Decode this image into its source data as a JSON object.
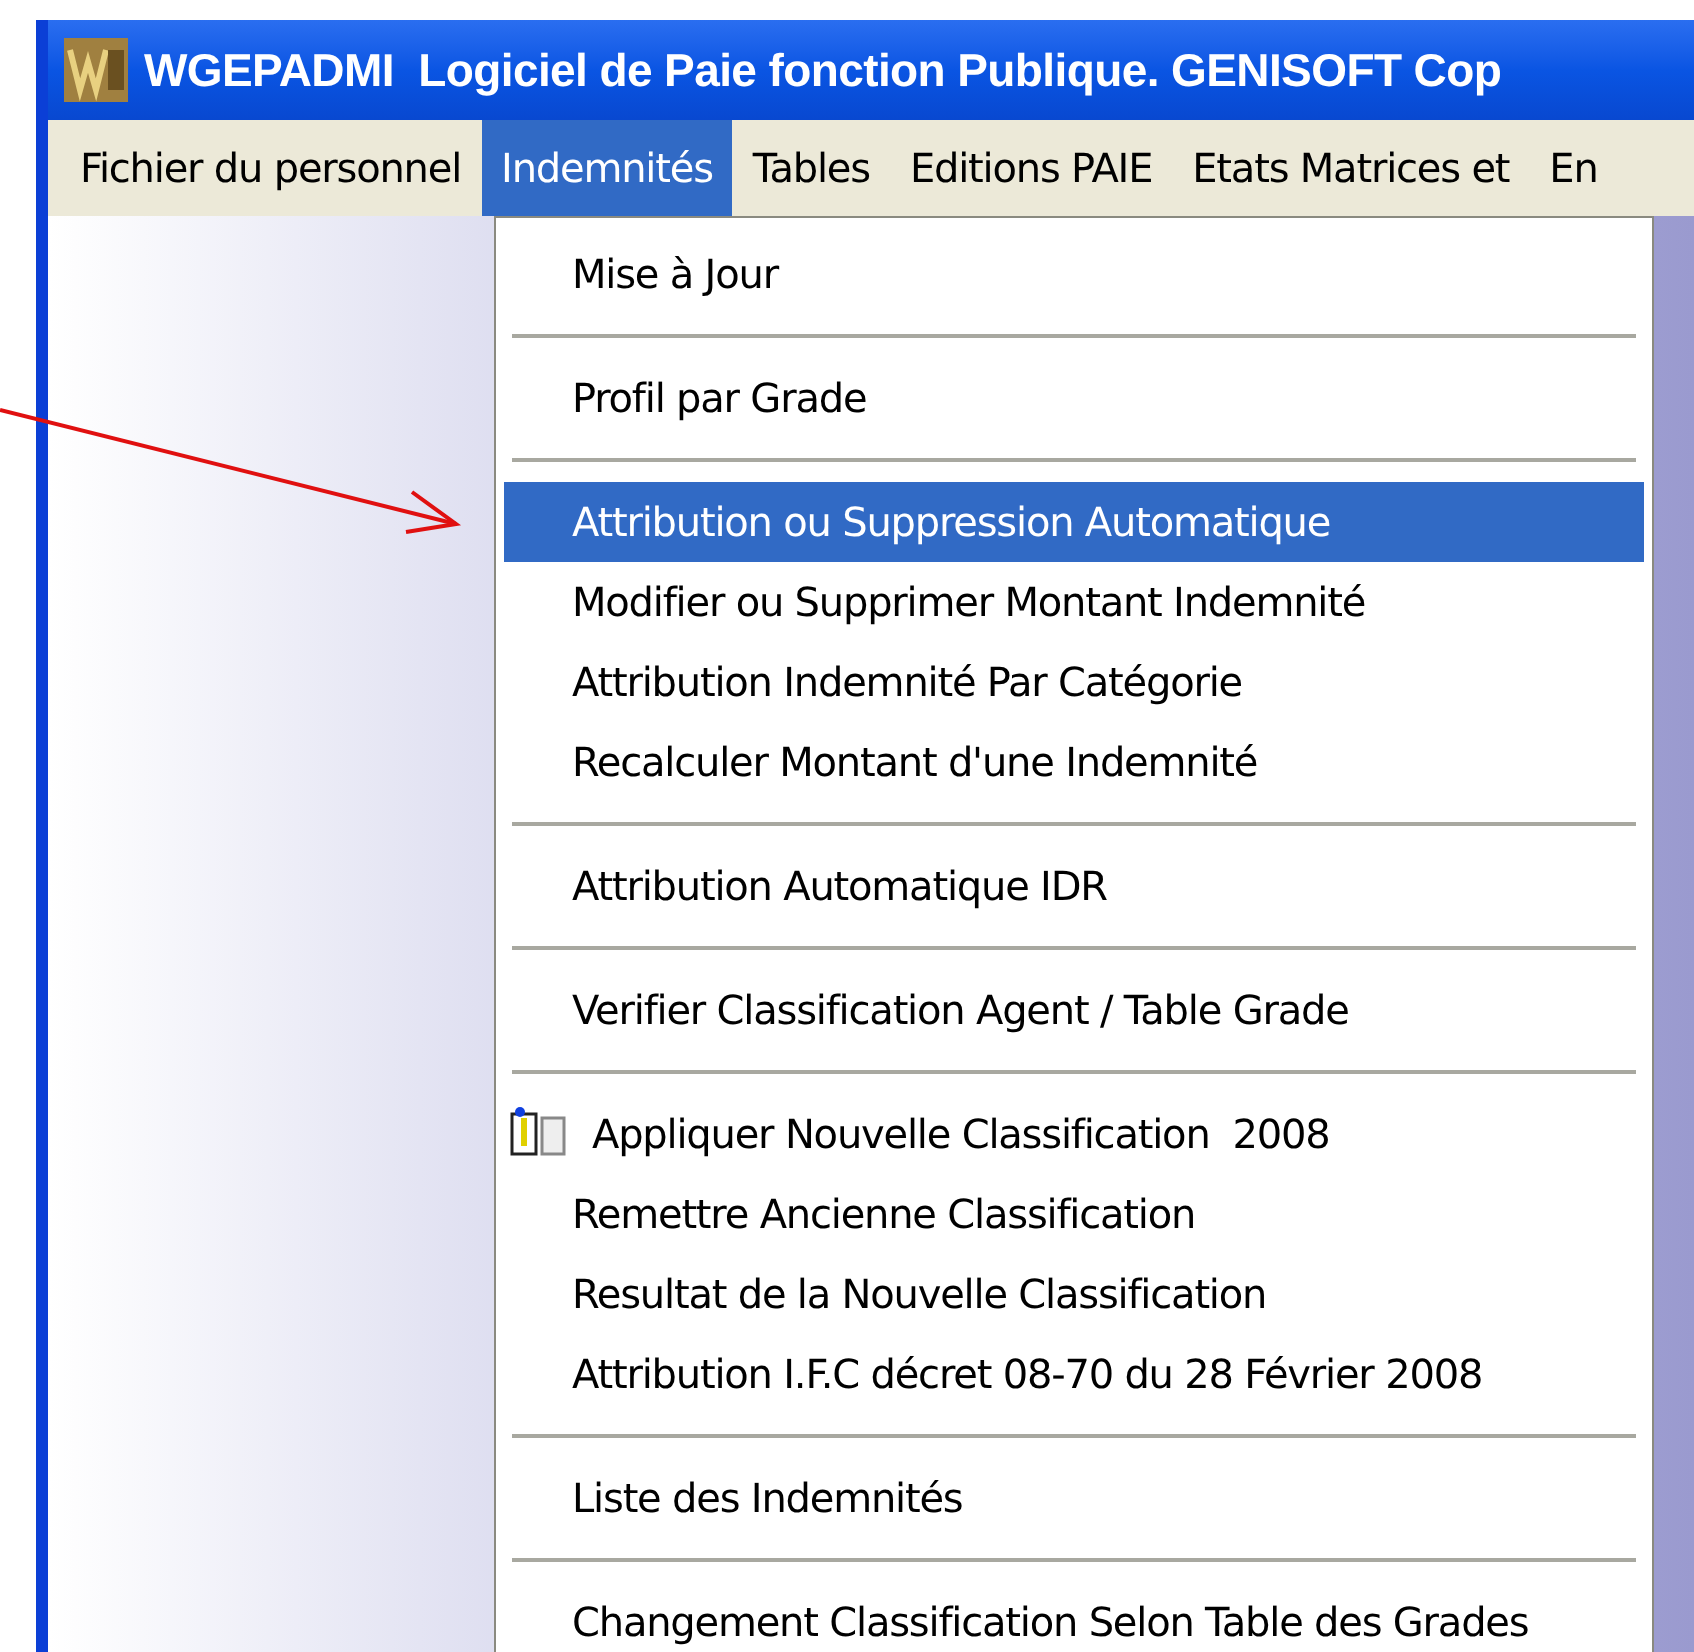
{
  "window": {
    "title": "WGEPADMI  Logiciel de Paie fonction Publique. GENISOFT Cop"
  },
  "menu_bar": [
    {
      "label": "Fichier du personnel",
      "selected": false
    },
    {
      "label": "Indemnités",
      "selected": true
    },
    {
      "label": "Tables",
      "selected": false
    },
    {
      "label": "Editions PAIE",
      "selected": false
    },
    {
      "label": "Etats Matrices et",
      "selected": false
    },
    {
      "label": "En",
      "selected": false
    }
  ],
  "dropdown": [
    {
      "kind": "item",
      "label": "Mise à Jour",
      "selected": false
    },
    {
      "kind": "separator"
    },
    {
      "kind": "item",
      "label": "Profil par Grade",
      "selected": false
    },
    {
      "kind": "separator"
    },
    {
      "kind": "item",
      "label": "Attribution ou Suppression Automatique",
      "selected": true
    },
    {
      "kind": "item",
      "label": "Modifier ou Supprimer Montant Indemnité",
      "selected": false
    },
    {
      "kind": "item",
      "label": "Attribution Indemnité Par Catégorie",
      "selected": false
    },
    {
      "kind": "item",
      "label": "Recalculer Montant d'une Indemnité",
      "selected": false
    },
    {
      "kind": "separator"
    },
    {
      "kind": "item",
      "label": "Attribution Automatique IDR",
      "selected": false
    },
    {
      "kind": "separator"
    },
    {
      "kind": "item",
      "label": "Verifier Classification Agent / Table Grade",
      "selected": false
    },
    {
      "kind": "separator"
    },
    {
      "kind": "icon_item",
      "label": "Appliquer Nouvelle Classification  2008",
      "selected": false
    },
    {
      "kind": "item",
      "label": "Remettre Ancienne Classification",
      "selected": false
    },
    {
      "kind": "item",
      "label": "Resultat de la Nouvelle Classification",
      "selected": false
    },
    {
      "kind": "item",
      "label": "Attribution I.F.C décret 08-70 du 28 Février 2008",
      "selected": false
    },
    {
      "kind": "separator"
    },
    {
      "kind": "item",
      "label": "Liste des Indemnités",
      "selected": false
    },
    {
      "kind": "separator"
    },
    {
      "kind": "item",
      "label": "Changement Classification Selon Table des Grades",
      "selected": false
    }
  ]
}
